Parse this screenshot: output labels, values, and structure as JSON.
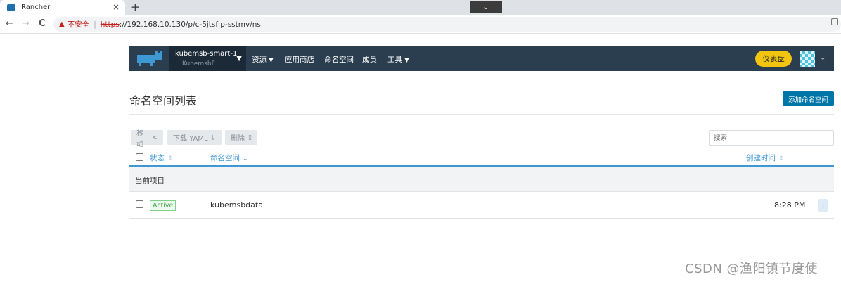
{
  "browser": {
    "tab_title": "Rancher",
    "tab_close": "×",
    "new_tab": "+",
    "tab_search_icon": "chevron-down-icon",
    "nav_back": "←",
    "nav_forward": "→",
    "nav_reload": "C",
    "insecure_label": "不安全",
    "url_scheme": "https",
    "url_rest": "://192.168.10.130/p/c-5jtsf:p-sstmv/ns"
  },
  "header": {
    "cluster_name": "kubemsb-smart-1",
    "project_name": "KubemsbF",
    "nav": [
      {
        "label": "资源",
        "dropdown": true
      },
      {
        "label": "应用商店",
        "dropdown": false
      },
      {
        "label": "命名空间",
        "dropdown": false
      },
      {
        "label": "成员",
        "dropdown": false
      },
      {
        "label": "工具",
        "dropdown": true
      }
    ],
    "dashboard_button": "仪表盘"
  },
  "page": {
    "title": "命名空间列表",
    "add_button": "添加命名空间"
  },
  "actions": {
    "move": "移动",
    "download": "下载 YAML",
    "delete": "删除",
    "search_placeholder": "搜索"
  },
  "table": {
    "headers": {
      "state": "状态",
      "namespace": "命名空间",
      "created": "创建时间"
    },
    "group_label": "当前项目",
    "rows": [
      {
        "state": "Active",
        "name": "kubemsbdata",
        "created": "8:28 PM"
      }
    ]
  },
  "watermark": "CSDN @渔阳镇节度使",
  "colors": {
    "header_bg": "#2b3e50",
    "accent_blue": "#3d98d3",
    "primary_button": "#0075a8",
    "dashboard_button": "#f1c40f",
    "active_badge": "#4aa552"
  }
}
